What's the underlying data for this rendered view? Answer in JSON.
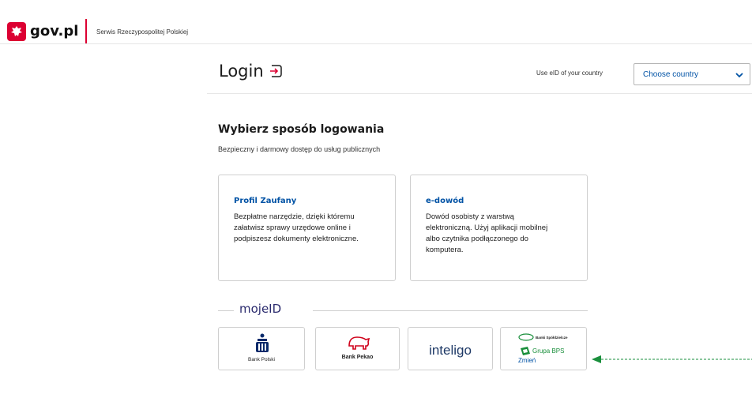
{
  "header": {
    "logo_text": "gov.pl",
    "service_name": "Serwis Rzeczypospolitej Polskiej",
    "brand_color": "#dc0032"
  },
  "login": {
    "title": "Login",
    "eid_label": "Use eID of your country",
    "country_select": "Choose country"
  },
  "section": {
    "title": "Wybierz sposób logowania",
    "subtitle": "Bezpieczny i darmowy dostęp do usług publicznych"
  },
  "cards": [
    {
      "title": "Profil Zaufany",
      "lines": [
        "Bezpłatne narzędzie, dzięki któremu",
        "załatwisz sprawy urzędowe online i",
        "podpiszesz dokumenty elektroniczne."
      ]
    },
    {
      "title": "e-dowód",
      "lines": [
        "Dowód osobisty z warstwą",
        "elektroniczną. Użyj aplikacji mobilnej",
        "albo czytnika podłączonego do",
        "komputera."
      ]
    }
  ],
  "mojeid": {
    "label": "mojeID"
  },
  "banks": [
    {
      "name": "Bank Polski"
    },
    {
      "name": "Bank Pekao"
    },
    {
      "name": "inteligo"
    },
    {
      "name": "Banki Spółdzielcze",
      "group": "Grupa BPS",
      "action": "Zmień"
    }
  ],
  "colors": {
    "link": "#0052a5",
    "arrow": "#1a8f3c"
  }
}
